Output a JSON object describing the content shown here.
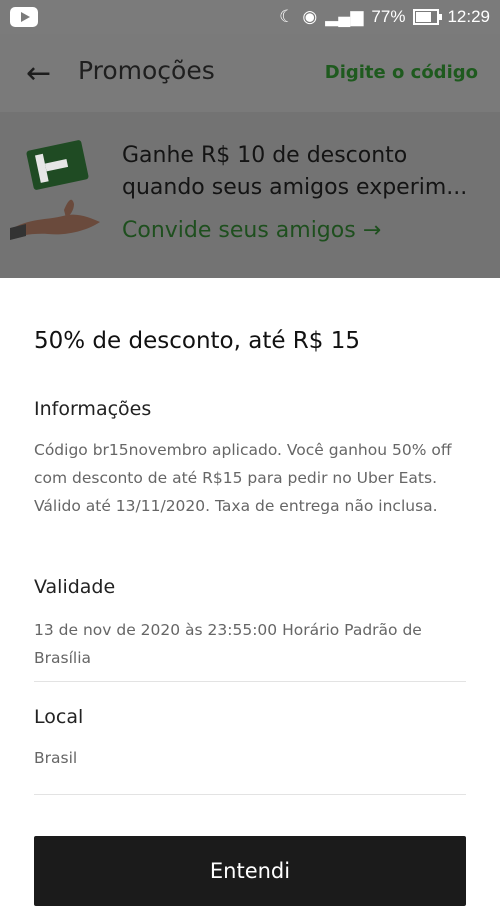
{
  "status_bar": {
    "battery": "77%",
    "time": "12:29",
    "icons": [
      "youtube-icon",
      "moon-alarm-icon",
      "wifi-icon",
      "signal-icon",
      "battery-icon"
    ]
  },
  "header": {
    "title": "Promoções",
    "enter_code": "Digite o código",
    "back_icon": "arrow-left-icon"
  },
  "banner": {
    "line1": "Ganhe R$ 10 de desconto",
    "line2": "quando seus amigos experim...",
    "link": "Convide seus amigos →"
  },
  "sheet": {
    "title": "50% de desconto, até R$ 15",
    "info_label": "Informações",
    "info_text": "Código br15novembro aplicado. Você ganhou 50% off com desconto de até R$15 para pedir no Uber Eats. Válido até 13/11/2020. Taxa de entrega não inclusa.",
    "validity_label": "Validade",
    "validity_text": "13 de nov de 2020 às 23:55:00 Horário Padrão de Brasília",
    "location_label": "Local",
    "location_text": "Brasil",
    "button": "Entendi"
  },
  "colors": {
    "overlay": "#7a7a7a",
    "link_green": "#1e5a1e",
    "button_bg": "#1b1b1b"
  }
}
